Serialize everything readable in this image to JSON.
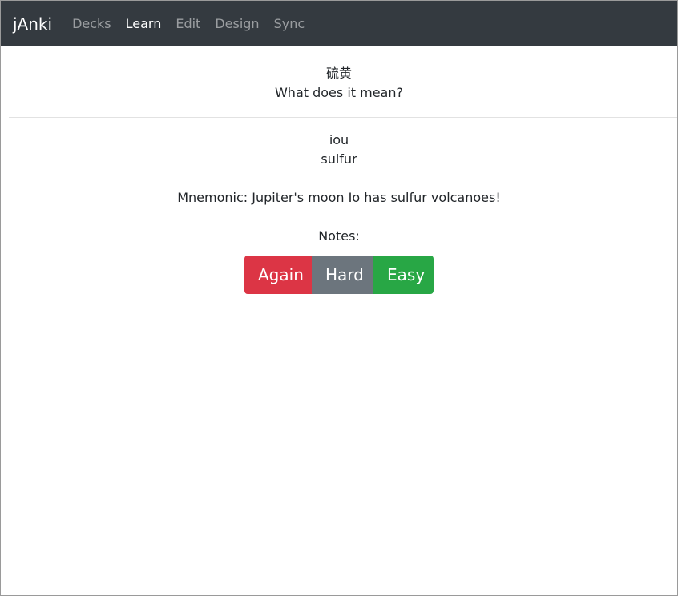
{
  "navbar": {
    "brand": "jAnki",
    "items": [
      {
        "label": "Decks"
      },
      {
        "label": "Learn"
      },
      {
        "label": "Edit"
      },
      {
        "label": "Design"
      },
      {
        "label": "Sync"
      }
    ],
    "active": "Learn",
    "bg_color": "#343a40"
  },
  "card": {
    "front": {
      "term": "硫黄",
      "prompt": "What does it mean?"
    },
    "back": {
      "reading": "iou",
      "meaning": "sulfur",
      "mnemonic": "Mnemonic: Jupiter's moon Io has sulfur volcanoes!",
      "notes": "Notes:"
    }
  },
  "answer_buttons": {
    "again": {
      "label": "Again",
      "color": "#dc3545"
    },
    "hard": {
      "label": "Hard",
      "color": "#6c757d"
    },
    "easy": {
      "label": "Easy",
      "color": "#28a745"
    }
  }
}
